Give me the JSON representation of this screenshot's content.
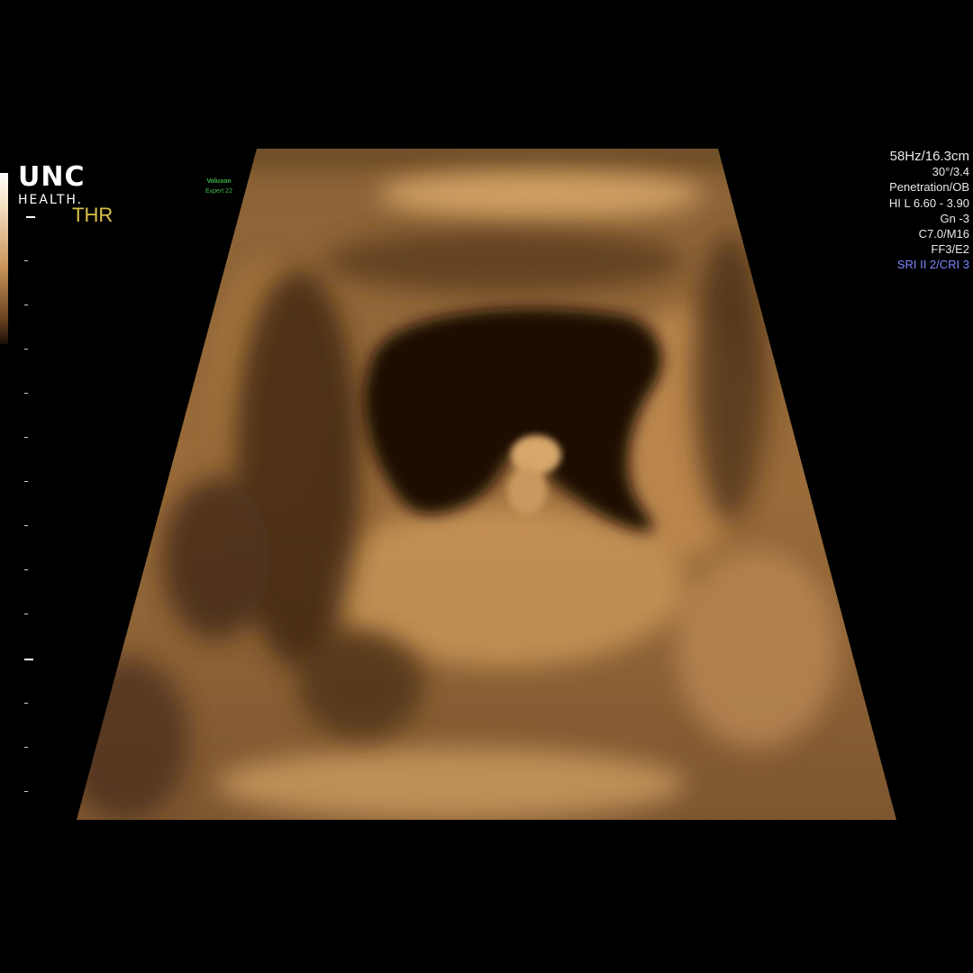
{
  "logo": {
    "line1": "UNC",
    "line2": "HEALTH."
  },
  "mode_label": "THR",
  "device": {
    "brand": "Voluson",
    "model": "Expert 22"
  },
  "params": [
    "58Hz/16.3cm",
    "30°/3.4",
    "Penetration/OB",
    "HI L  6.60 - 3.90",
    "Gn  -3",
    "C7.0/M16",
    "FF3/E2",
    "SRI II 2/CRI 3"
  ],
  "colors": {
    "background": "#000000",
    "tint": "#b07a40",
    "mode_label": "#d9c24a",
    "brand": "#3fb94a",
    "sri": "#7c88ff"
  },
  "icons": [
    "grey-scale-bar",
    "depth-scale"
  ]
}
